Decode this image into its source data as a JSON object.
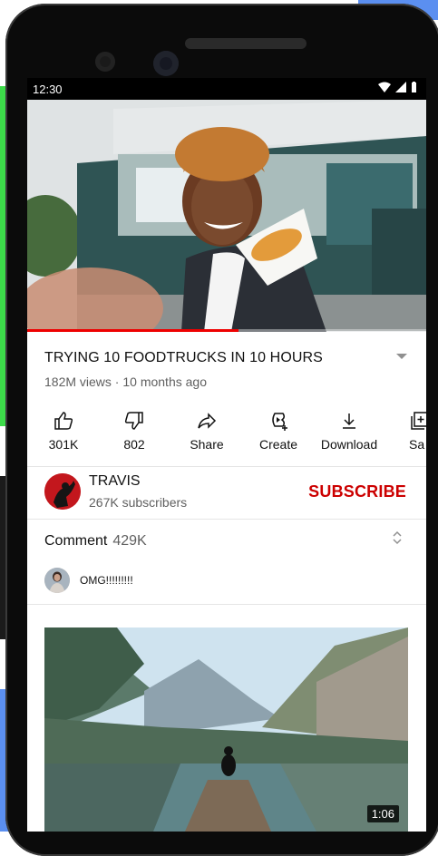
{
  "status_bar": {
    "time": "12:30"
  },
  "video": {
    "progress_percent": 53
  },
  "video_info": {
    "title": "TRYING 10 FOODTRUCKS IN 10 HOURS",
    "meta": "182M views · 10 months ago"
  },
  "actions": [
    {
      "name": "like",
      "label": "301K",
      "icon": "thumb-up-icon"
    },
    {
      "name": "dislike",
      "label": "802",
      "icon": "thumb-down-icon"
    },
    {
      "name": "share",
      "label": "Share",
      "icon": "share-icon"
    },
    {
      "name": "create",
      "label": "Create",
      "icon": "create-icon"
    },
    {
      "name": "download",
      "label": "Download",
      "icon": "download-icon"
    },
    {
      "name": "save",
      "label": "Sa",
      "icon": "save-icon"
    }
  ],
  "channel": {
    "name": "TRAVIS",
    "subscribers": "267K subscribers",
    "subscribe_label": "SUBSCRIBE"
  },
  "comments": {
    "label": "Comment",
    "count": "429K",
    "top_comment": "OMG!!!!!!!!!"
  },
  "next_video": {
    "duration": "1:06"
  },
  "colors": {
    "accent": "#cc0000",
    "progress": "#ee0000",
    "text_secondary": "#606060"
  }
}
